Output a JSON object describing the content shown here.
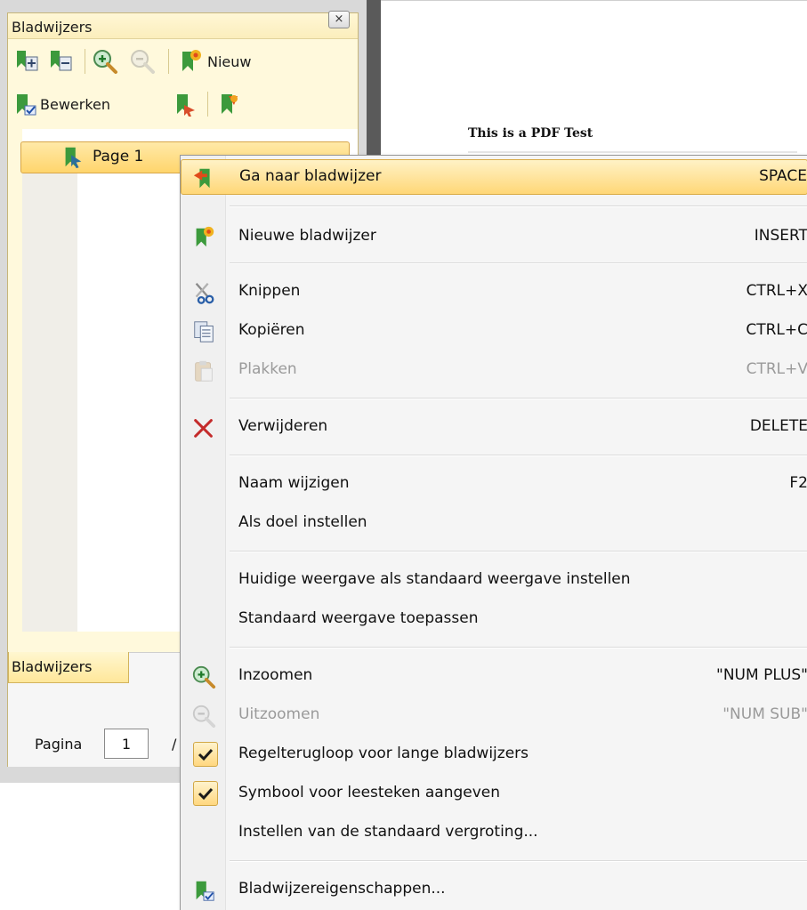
{
  "panel": {
    "title": "Bladwijzers",
    "close_glyph": "×",
    "toolbar1": {
      "buttons": [
        "expand-all-icon",
        "collapse-all-icon",
        "zoom-in-icon",
        "zoom-out-icon"
      ],
      "new_label": "Nieuw"
    },
    "toolbar2": {
      "edit_label": "Bewerken"
    },
    "tree": {
      "items": [
        {
          "label": "Page 1"
        }
      ]
    },
    "bottom_tab": "Bladwijzers",
    "pager": {
      "label": "Pagina",
      "value": "1",
      "separator": "/"
    }
  },
  "document": {
    "title": "This is a PDF Test"
  },
  "context_menu": {
    "items": [
      {
        "label": "Ga naar bladwijzer",
        "shortcut": "SPACE",
        "highlighted": true
      },
      {
        "label": "Nieuwe bladwijzer",
        "shortcut": "INSERT"
      },
      {
        "label": "Knippen",
        "shortcut": "CTRL+X"
      },
      {
        "label": "Kopiëren",
        "shortcut": "CTRL+C"
      },
      {
        "label": "Plakken",
        "shortcut": "CTRL+V",
        "disabled": true
      },
      {
        "label": "Verwijderen",
        "shortcut": "DELETE"
      },
      {
        "label": "Naam wijzigen",
        "shortcut": "F2"
      },
      {
        "label": "Als doel instellen",
        "shortcut": ""
      },
      {
        "label": "Huidige weergave als standaard weergave instellen",
        "shortcut": ""
      },
      {
        "label": "Standaard weergave toepassen",
        "shortcut": ""
      },
      {
        "label": "Inzoomen",
        "shortcut": "\"NUM PLUS\""
      },
      {
        "label": "Uitzoomen",
        "shortcut": "\"NUM SUB\"",
        "disabled": true
      },
      {
        "label": "Regelterugloop voor lange bladwijzers",
        "shortcut": "",
        "checked": true
      },
      {
        "label": "Symbool voor leesteken aangeven",
        "shortcut": "",
        "checked": true
      },
      {
        "label": "Instellen van de standaard vergroting...",
        "shortcut": ""
      },
      {
        "label": "Bladwijzereigenschappen...",
        "shortcut": ""
      }
    ]
  },
  "colors": {
    "highlight": "#ffd777",
    "panel_bg": "#fff9dc",
    "delete_red": "#c42b2b",
    "bookmark_green": "#3c9a3c"
  }
}
